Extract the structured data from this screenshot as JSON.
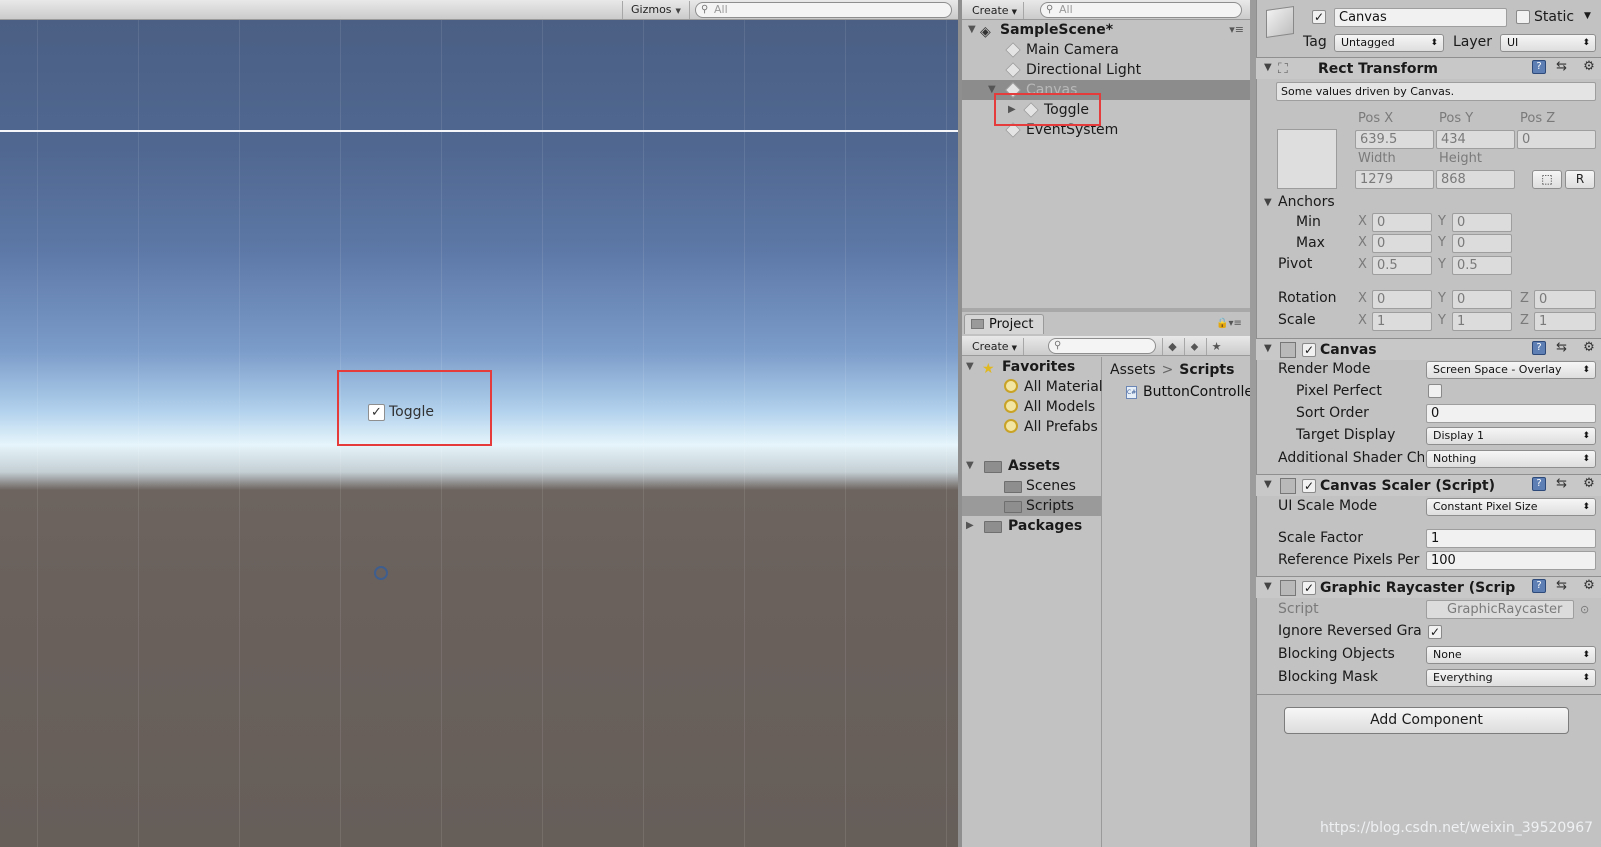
{
  "scene": {
    "gizmos_label": "Gizmos",
    "search_placeholder": "All",
    "toggle_label": "Toggle",
    "toggle_checked": true
  },
  "hierarchy": {
    "create_label": "Create",
    "search_placeholder": "All",
    "scene_name": "SampleScene*",
    "items": [
      {
        "label": "Main Camera"
      },
      {
        "label": "Directional Light"
      },
      {
        "label": "Canvas"
      },
      {
        "label": "Toggle"
      },
      {
        "label": "EventSystem"
      }
    ]
  },
  "project": {
    "tab_label": "Project",
    "create_label": "Create",
    "favorites": {
      "label": "Favorites",
      "items": [
        "All Materials",
        "All Models",
        "All Prefabs"
      ]
    },
    "assets": {
      "label": "Assets",
      "items": [
        "Scenes",
        "Scripts"
      ]
    },
    "packages_label": "Packages",
    "breadcrumb": [
      "Assets",
      "Scripts"
    ],
    "files": [
      "ButtonController"
    ]
  },
  "inspector": {
    "object_name": "Canvas",
    "static_label": "Static",
    "tag_label": "Tag",
    "tag_value": "Untagged",
    "layer_label": "Layer",
    "layer_value": "UI",
    "rect_transform": {
      "title": "Rect Transform",
      "note": "Some values driven by Canvas.",
      "pos_x_label": "Pos X",
      "pos_y_label": "Pos Y",
      "pos_z_label": "Pos Z",
      "pos_x": "639.5",
      "pos_y": "434",
      "pos_z": "0",
      "width_label": "Width",
      "height_label": "Height",
      "width": "1279",
      "height": "868",
      "r_button": "R",
      "anchors_label": "Anchors",
      "min_label": "Min",
      "max_label": "Max",
      "x_label": "X",
      "y_label": "Y",
      "z_label": "Z",
      "min_x": "0",
      "min_y": "0",
      "max_x": "0",
      "max_y": "0",
      "pivot_label": "Pivot",
      "pivot_x": "0.5",
      "pivot_y": "0.5",
      "rotation_label": "Rotation",
      "rot_x": "0",
      "rot_y": "0",
      "rot_z": "0",
      "scale_label": "Scale",
      "scale_x": "1",
      "scale_y": "1",
      "scale_z": "1"
    },
    "canvas": {
      "title": "Canvas",
      "render_mode_label": "Render Mode",
      "render_mode": "Screen Space - Overlay",
      "pixel_perfect_label": "Pixel Perfect",
      "sort_order_label": "Sort Order",
      "sort_order": "0",
      "target_display_label": "Target Display",
      "target_display": "Display 1",
      "shader_label": "Additional Shader Ch",
      "shader_value": "Nothing"
    },
    "canvas_scaler": {
      "title": "Canvas Scaler (Script)",
      "ui_scale_mode_label": "UI Scale Mode",
      "ui_scale_mode": "Constant Pixel Size",
      "scale_factor_label": "Scale Factor",
      "scale_factor": "1",
      "ref_ppu_label": "Reference Pixels Per",
      "ref_ppu": "100"
    },
    "graphic_raycaster": {
      "title": "Graphic Raycaster (Scrip",
      "script_label": "Script",
      "script_value": "GraphicRaycaster",
      "ignore_reversed_label": "Ignore Reversed Gra",
      "blocking_objects_label": "Blocking Objects",
      "blocking_objects": "None",
      "blocking_mask_label": "Blocking Mask",
      "blocking_mask": "Everything"
    },
    "add_component": "Add Component"
  },
  "watermark": "https://blog.csdn.net/weixin_39520967"
}
